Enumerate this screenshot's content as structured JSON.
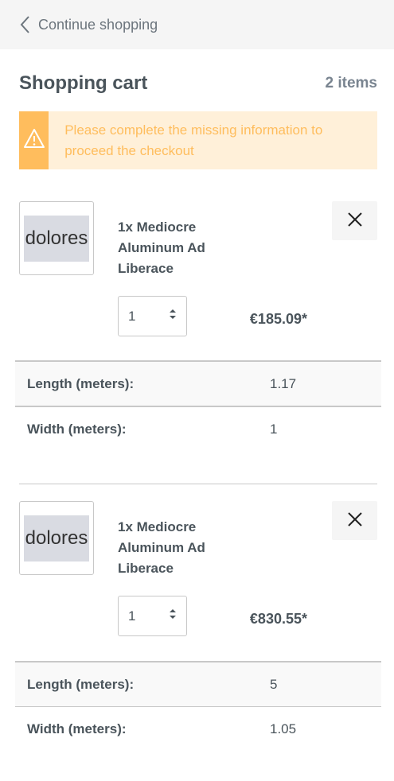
{
  "nav": {
    "back_label": "Continue shopping",
    "back_icon": "chevron-left-icon"
  },
  "cart": {
    "title": "Shopping cart",
    "count": "2 items"
  },
  "alert": {
    "icon": "warning-icon",
    "message": "Please complete the missing information to proceed the checkout",
    "color": "#ffbd5d",
    "background": "#fff0d9"
  },
  "items": [
    {
      "thumbnail_text": "dolores",
      "name": "1x Mediocre Aluminum Ad Liberace",
      "quantity": "1",
      "price": "€185.09*",
      "properties": [
        {
          "label": "Length (meters):",
          "value": "1.17"
        },
        {
          "label": "Width (meters):",
          "value": "1"
        }
      ]
    },
    {
      "thumbnail_text": "dolores",
      "name": "1x Mediocre Aluminum Ad Liberace",
      "quantity": "1",
      "price": "€830.55*",
      "properties": [
        {
          "label": "Length (meters):",
          "value": "5"
        },
        {
          "label": "Width (meters):",
          "value": "1.05"
        }
      ]
    }
  ]
}
